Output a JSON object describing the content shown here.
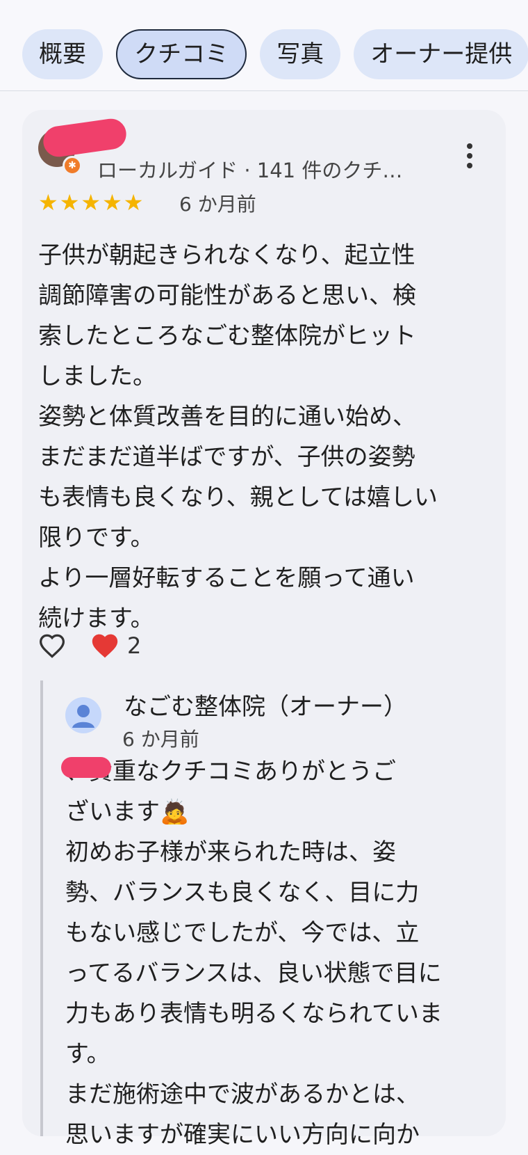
{
  "tabs": [
    {
      "label": "概要"
    },
    {
      "label": "クチコミ"
    },
    {
      "label": "写真"
    },
    {
      "label": "オーナー提供"
    }
  ],
  "review": {
    "author_meta": "ローカルガイド · 141 件のクチ…",
    "rating": 5,
    "stars": "★★★★★",
    "time": "6 か月前",
    "text": "子供が朝起きられなくなり、起立性\n調節障害の可能性があると思い、検\n索したところなごむ整体院がヒット\nしました。\n姿勢と体質改善を目的に通い始め、\nまだまだ道半ばですが、子供の姿勢\nも表情も良くなり、親としては嬉しい\n限りです。\nより一層好転することを願って通い\n続けます。",
    "reaction_count": "2"
  },
  "owner_reply": {
    "name": "なごむ整体院（オーナー）",
    "time": "6 か月前",
    "text": "      、貴重なクチコミありがとうご\nざいます🙇\n初めお子様が来られた時は、姿\n勢、バランスも良くなく、目に力\nもない感じでしたが、今では、立\nってるバランスは、良い状態で目に\n力もあり表情も明るくなられていま\nす。\nまだ施術途中で波があるかとは、\n思いますが確実にいい方向に向か"
  },
  "colors": {
    "star": "#f5b400",
    "heart": "#e53935",
    "tab_bg": "#dde6f8",
    "redaction": "#f0406b"
  }
}
